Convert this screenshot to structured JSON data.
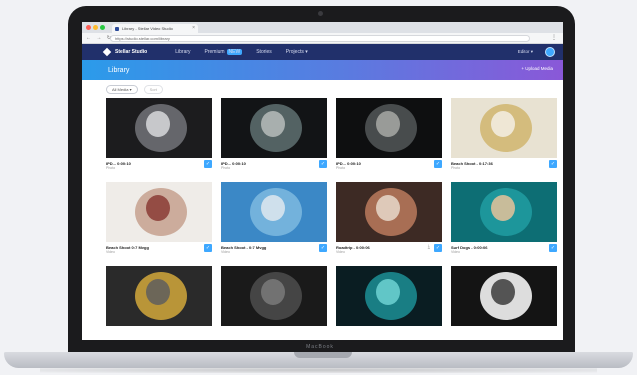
{
  "browser": {
    "tab_title": "Library - Stellar Video Studio",
    "tab_close": "×",
    "nav_buttons": "← → ↻",
    "url": "https://studio.stellar.com/library",
    "menu": "⋮"
  },
  "app": {
    "brand": "Stellar Studio",
    "nav": [
      {
        "label": "Library"
      },
      {
        "label": "Premium",
        "badge": "NEW"
      },
      {
        "label": "Stories"
      },
      {
        "label": "Projects ▾"
      }
    ],
    "account_label": "Editor ▾"
  },
  "banner": {
    "title": "Library",
    "cta": "+ Upload Media"
  },
  "filters": {
    "primary": "All Media ▾",
    "secondary": "Sort"
  },
  "cards": [
    {
      "title": "IPD... 0:00:10",
      "sub": "Photo",
      "palette": [
        "#1c1c1e",
        "#6e6f73",
        "#d8d9dc"
      ]
    },
    {
      "title": "IPD... 0:00:10",
      "sub": "Photo",
      "palette": [
        "#121416",
        "#5b6a6c",
        "#b7bdbb"
      ]
    },
    {
      "title": "IPD... 0:00:10",
      "sub": "Photo",
      "palette": [
        "#0e0f10",
        "#4f5354",
        "#a8a9a6"
      ]
    },
    {
      "title": "Beach Shoot - 0:17:36",
      "sub": "Photo",
      "palette": [
        "#e8e2d2",
        "#d1b873",
        "#f3efe4"
      ]
    },
    {
      "title": "Beach Shoot 0:7 Mvgg",
      "sub": "Video",
      "palette": [
        "#efece8",
        "#c8a593",
        "#8a3b35"
      ]
    },
    {
      "title": "Beach Shoot - 0:7 Mvgg",
      "sub": "Video",
      "palette": [
        "#3b88c6",
        "#7ab7de",
        "#dfe8ef"
      ]
    },
    {
      "title": "Roadtrip - 0:00:06",
      "sub": "Video",
      "palette": [
        "#3d2a24",
        "#b4765a",
        "#e7d9cb"
      ]
    },
    {
      "title": "Surf Dogs - 0:00:06",
      "sub": "Video",
      "palette": [
        "#0d6e74",
        "#1f9aa0",
        "#e6c39a"
      ]
    },
    {
      "title": "",
      "sub": "",
      "palette": [
        "#2a2a2a",
        "#c9a13a",
        "#5e5e5e"
      ]
    },
    {
      "title": "",
      "sub": "",
      "palette": [
        "#1a1a1a",
        "#4a4a4a",
        "#7a7a7a"
      ]
    },
    {
      "title": "",
      "sub": "",
      "palette": [
        "#0a1d22",
        "#1b8a8f",
        "#6fd2d2"
      ]
    },
    {
      "title": "",
      "sub": "",
      "palette": [
        "#141414",
        "#f3f3f3",
        "#3c3c3c"
      ]
    }
  ],
  "laptop_brand": "MacBook"
}
